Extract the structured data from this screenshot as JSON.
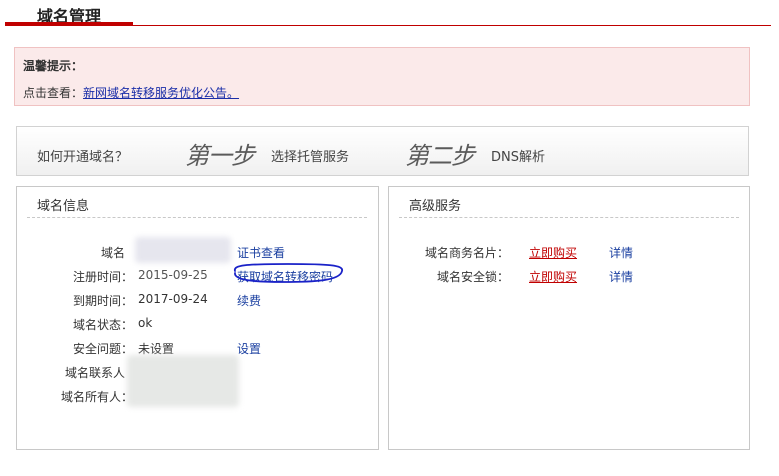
{
  "header": {
    "title": "域名管理"
  },
  "notice": {
    "title": "温馨提示：",
    "prefix": "点击查看：",
    "link": "新网域名转移服务优化公告。"
  },
  "steps": {
    "question": "如何开通域名？",
    "step1_label": "第一步",
    "step1_text": "选择托管服务",
    "step2_label": "第二步",
    "step2_text": "DNS解析"
  },
  "domain_info": {
    "title": "域名信息",
    "rows": [
      {
        "label": "域名",
        "value": "",
        "action": "证书查看"
      },
      {
        "label": "注册时间：",
        "value": "2015-09-25",
        "action": "获取域名转移密码"
      },
      {
        "label": "到期时间：",
        "value": "2017-09-24",
        "action": "续费"
      },
      {
        "label": "域名状态：",
        "value": "ok",
        "action": ""
      },
      {
        "label": "安全问题：",
        "value": "未设置",
        "action": "设置"
      },
      {
        "label": "域名联系人",
        "value": "",
        "action": ""
      },
      {
        "label": "域名所有人：",
        "value": "",
        "action": ""
      }
    ]
  },
  "advanced": {
    "title": "高级服务",
    "rows": [
      {
        "label": "域名商务名片：",
        "buy": "立即购买",
        "detail": "详情"
      },
      {
        "label": "域名安全锁：",
        "buy": "立即购买",
        "detail": "详情"
      }
    ]
  },
  "colors": {
    "accent": "#c00000",
    "link": "#1a3fa0",
    "notice_bg": "#fbeaea",
    "annotation": "#1a22c8"
  }
}
